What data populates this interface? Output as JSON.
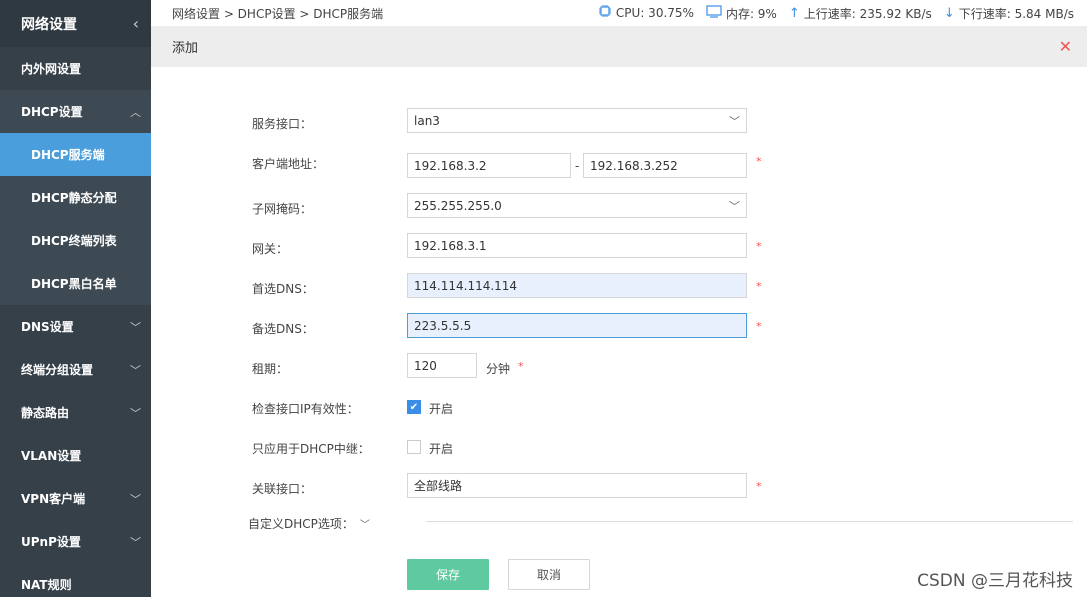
{
  "sidebar": {
    "title": "网络设置",
    "items": [
      {
        "label": "内外网设置"
      },
      {
        "label": "DHCP设置"
      },
      {
        "label": "DNS设置"
      },
      {
        "label": "终端分组设置"
      },
      {
        "label": "静态路由"
      },
      {
        "label": "VLAN设置"
      },
      {
        "label": "VPN客户端"
      },
      {
        "label": "UPnP设置"
      },
      {
        "label": "NAT规则"
      }
    ],
    "dhcp_sub": [
      {
        "label": "DHCP服务端",
        "active": true
      },
      {
        "label": "DHCP静态分配"
      },
      {
        "label": "DHCP终端列表"
      },
      {
        "label": "DHCP黑白名单"
      }
    ]
  },
  "topbar": {
    "breadcrumb": "网络设置 > DHCP设置 > DHCP服务端",
    "cpu": "CPU: 30.75%",
    "memory": "内存: 9%",
    "upload": "上行速率: 235.92 KB/s",
    "download": "下行速率: 5.84 MB/s"
  },
  "panel": {
    "title": "添加"
  },
  "form": {
    "interface_label": "服务接口：",
    "interface_value": "lan3",
    "client_addr_label": "客户端地址：",
    "client_addr_start": "192.168.3.2",
    "client_addr_sep": "-",
    "client_addr_end": "192.168.3.252",
    "subnet_label": "子网掩码：",
    "subnet_value": "255.255.255.0",
    "gateway_label": "网关：",
    "gateway_value": "192.168.3.1",
    "dns1_label": "首选DNS：",
    "dns1_value": "114.114.114.114",
    "dns2_label": "备选DNS：",
    "dns2_value": "223.5.5.5",
    "lease_label": "租期：",
    "lease_value": "120",
    "lease_unit": "分钟",
    "check_ip_label": "检查接口IP有效性：",
    "check_ip_text": "开启",
    "check_ip_on": true,
    "relay_label": "只应用于DHCP中继：",
    "relay_text": "开启",
    "relay_on": false,
    "link_label": "关联接口：",
    "link_value": "全部线路",
    "custom_label": "自定义DHCP选项：",
    "required_mark": "*"
  },
  "buttons": {
    "save": "保存",
    "cancel": "取消"
  },
  "watermark": "CSDN @三月花科技"
}
